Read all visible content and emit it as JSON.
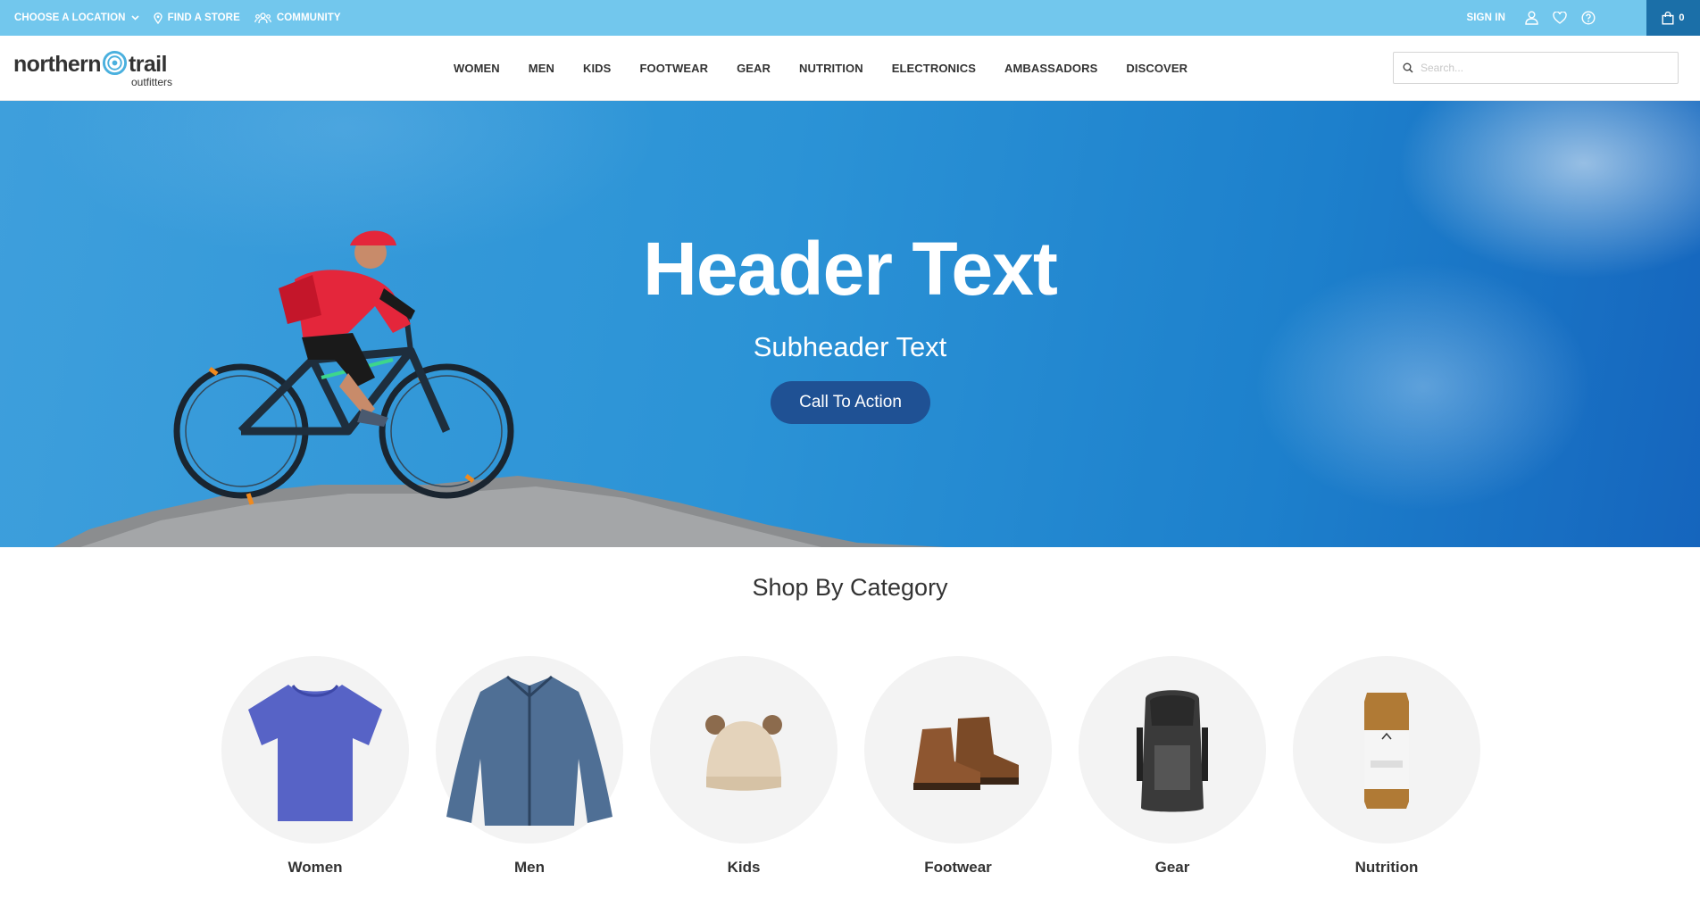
{
  "utility": {
    "location_label": "CHOOSE A LOCATION",
    "store_label": "FIND A STORE",
    "community_label": "COMMUNITY",
    "sign_in_label": "SIGN IN",
    "cart_count": "0"
  },
  "logo": {
    "main_left": "northern",
    "main_right": "trail",
    "sub": "outfitters"
  },
  "nav": {
    "items": [
      "WOMEN",
      "MEN",
      "KIDS",
      "FOOTWEAR",
      "GEAR",
      "NUTRITION",
      "ELECTRONICS",
      "AMBASSADORS",
      "DISCOVER"
    ]
  },
  "search": {
    "placeholder": "Search...",
    "value": ""
  },
  "hero": {
    "title": "Header Text",
    "subtitle": "Subheader Text",
    "cta_label": "Call To Action"
  },
  "categories": {
    "heading": "Shop By Category",
    "items": [
      {
        "label": "Women",
        "icon": "t-shirt-icon"
      },
      {
        "label": "Men",
        "icon": "jacket-icon"
      },
      {
        "label": "Kids",
        "icon": "beanie-icon"
      },
      {
        "label": "Footwear",
        "icon": "boots-icon"
      },
      {
        "label": "Gear",
        "icon": "backpack-icon"
      },
      {
        "label": "Nutrition",
        "icon": "can-icon"
      }
    ]
  },
  "colors": {
    "utility_bar": "#72c7ed",
    "cart_bg": "#1b6fa8",
    "cta_bg": "#1f5194",
    "hero_sky": "#2b93d6",
    "category_circle": "#f3f3f3"
  }
}
